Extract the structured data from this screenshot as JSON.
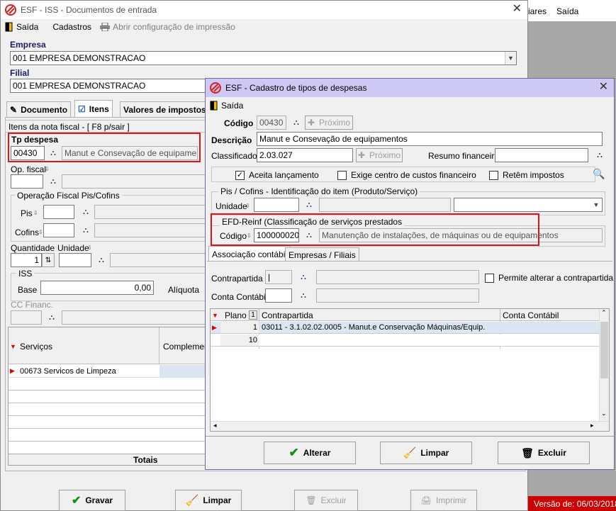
{
  "background": {
    "menu_right": [
      "iares",
      "Saída"
    ],
    "version_text": "Versão de: 06/03/2018"
  },
  "main": {
    "title": "ESF - ISS - Documentos de entrada",
    "menu": {
      "exit": "Saída",
      "cadastros": "Cadastros",
      "print_config": "Abrir configuração de impressão"
    },
    "empresa_label": "Empresa",
    "empresa_value": "001 EMPRESA DEMONSTRACAO",
    "filial_label": "Filial",
    "filial_value": "001 EMPRESA DEMONSTRACAO",
    "tabs": [
      "Documento",
      "Itens",
      "Valores de impostos"
    ],
    "items_header": "Itens da nota fiscal - [ F8 p/sair ]",
    "tp_despesa_label": "Tp despesa",
    "tp_despesa_code": "00430",
    "tp_despesa_desc": "Manut e Consevação de equipamentos",
    "op_fiscal_label": "Op. fiscal",
    "op_pis_cofins_label": "Operação Fiscal Pis/Cofins",
    "pis_label": "Pis",
    "cofins_label": "Cofins",
    "quantidade_label": "Quantidade",
    "unidade_label": "Unidade",
    "quantidade_value": "1",
    "iss_label": "ISS",
    "base_label": "Base",
    "base_value": "0,00",
    "aliquota_label": "Alíquota",
    "cc_financ_label": "CC Financ.",
    "grid_cols": [
      "Serviços",
      "Complemento"
    ],
    "grid_row": "00673 Servicos de Limpeza",
    "totais_label": "Totais",
    "buttons": {
      "gravar": "Gravar",
      "limpar": "Limpar",
      "excluir": "Excluir",
      "imprimir": "Imprimir"
    }
  },
  "modal": {
    "title": "ESF - Cadastro de tipos de despesas",
    "menu_exit": "Saída",
    "codigo_label": "Código",
    "codigo_value": "00430",
    "proximo_label": "Próximo",
    "descricao_label": "Descrição",
    "descricao_value": "Manut e Consevação de equipamentos",
    "classificador_label": "Classificador",
    "classificador_value": "2.03.027",
    "resumo_label": "Resumo financeiro",
    "aceita_label": "Aceita lançamento",
    "exige_label": "Exige centro de custos financeiro",
    "retem_label": "Retêm impostos",
    "pis_group_label": "Pis / Cofins - Identificação do item (Produto/Serviço)",
    "unidade_label": "Unidade",
    "efd_group_label": "EFD-Reinf (Classificação de serviços prestados",
    "efd_codigo_label": "Código",
    "efd_codigo_value": "100000020",
    "efd_desc": "Manutenção de instalações, de máquinas ou de equipamentos",
    "tabs": [
      "Associação contábil",
      "Empresas / Filiais"
    ],
    "contrapartida_label": "Contrapartida",
    "contrapartida_value": "|",
    "permite_label": "Permite alterar a contrapartida",
    "conta_contabil_label": "Conta Contábil",
    "grid_cols": [
      "Plano",
      "Contrapartida",
      "Conta Contábil"
    ],
    "grid_sort_badge": "1",
    "grid_rows": [
      {
        "plano": "1",
        "contrapartida": "03011 - 3.1.02.02.0005 - Manut.e Conservação Máquinas/Equip.",
        "conta": ""
      },
      {
        "plano": "10",
        "contrapartida": "",
        "conta": ""
      }
    ],
    "buttons": {
      "alterar": "Alterar",
      "limpar": "Limpar",
      "excluir": "Excluir"
    }
  }
}
